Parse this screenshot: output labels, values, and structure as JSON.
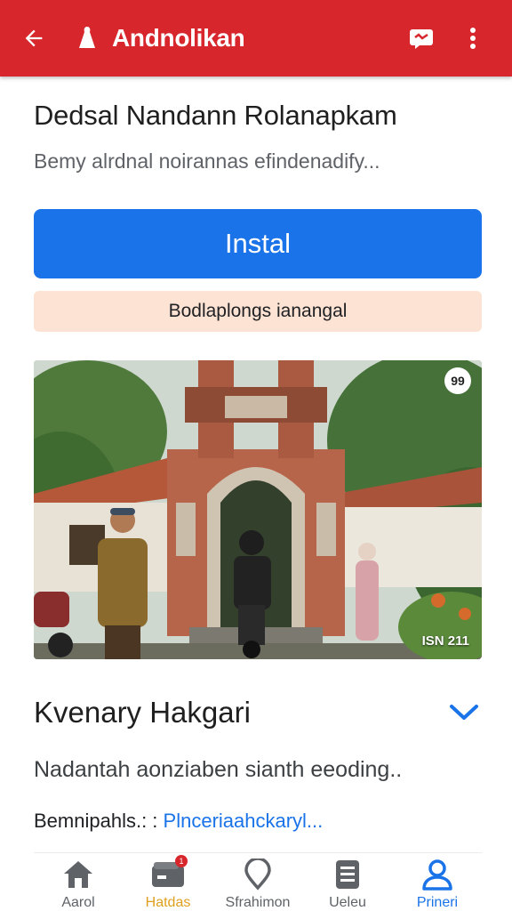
{
  "appbar": {
    "title": "Andnolikan",
    "back_icon": "arrow-left-icon",
    "logo_icon": "app-logo-icon",
    "action_icon": "message-icon",
    "menu_icon": "more-vert-icon",
    "color": "#d7262c"
  },
  "app": {
    "name": "Dedsal Nandann Rolanapkam",
    "subtitle": "Bemy alrdnal noirannas efindenadify..."
  },
  "install": {
    "label": "Instal",
    "color": "#1a73e8"
  },
  "notice": {
    "text": "Bodlaplongs ianangal",
    "color": "#fde3d3"
  },
  "screenshot": {
    "caption": "ISN 211",
    "badge": "99"
  },
  "section": {
    "title": "Kvenary Hakgari",
    "chevron_icon": "chevron-down-icon",
    "description": "Nadantah aonziaben sianth eeoding..",
    "meta_label": "Bemnipahls.: :",
    "meta_link": "Plnceriaahckaryl..."
  },
  "bottom_nav": {
    "items": [
      {
        "label": "Aarol",
        "icon": "home-icon"
      },
      {
        "label": "Hatdas",
        "icon": "wallet-icon",
        "badge": "1"
      },
      {
        "label": "Sfrahimon",
        "icon": "location-pin-icon"
      },
      {
        "label": "Ueleu",
        "icon": "document-icon"
      },
      {
        "label": "Prineri",
        "icon": "person-icon"
      }
    ]
  }
}
